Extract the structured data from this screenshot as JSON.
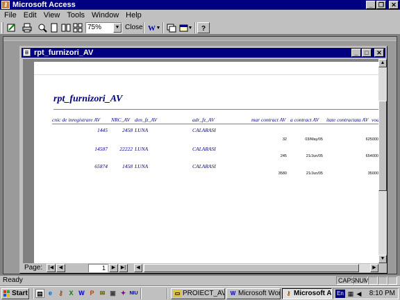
{
  "app": {
    "title": "Microsoft Access"
  },
  "menu": [
    "File",
    "Edit",
    "View",
    "Tools",
    "Window",
    "Help"
  ],
  "toolbar": {
    "zoom": "75%",
    "close_label": "Close"
  },
  "report_window": {
    "title": "rpt_furnizori_AV"
  },
  "report": {
    "title": "rpt_furnizori_AV",
    "headers": [
      "cnic de inregistrare AV",
      "NRC_AV",
      "den_fz_AV",
      "adr_fz_AV",
      "mar contract AV",
      "a contract AV",
      "itate contractata AV",
      "vod"
    ],
    "rows": [
      {
        "cod": "1445",
        "nrc": "2458",
        "den": "LUNA",
        "adr": "CALARASI",
        "nr_contract": "32",
        "data_contract": "03/May/05",
        "cantitate": "625000"
      },
      {
        "cod": "14587",
        "nrc": "22222",
        "den": "LUNA",
        "adr": "CALARASI",
        "nr_contract": "245",
        "data_contract": "21/Jun/05",
        "cantitate": "654000"
      },
      {
        "cod": "65874",
        "nrc": "1458",
        "den": "LUNA",
        "adr": "CALARASI",
        "nr_contract": "3580",
        "data_contract": "21/Jun/05",
        "cantitate": "35000"
      }
    ]
  },
  "navigation": {
    "label": "Page:",
    "page": "1"
  },
  "status": {
    "text": "Ready",
    "caps": "CAPS",
    "num": "NUM"
  },
  "taskbar": {
    "start": "Start",
    "tasks": [
      "PROIECT_AV",
      "Microsoft Word ...",
      "Microsoft Acc..."
    ],
    "tray_lang": "En",
    "clock": "8:10 PM"
  }
}
